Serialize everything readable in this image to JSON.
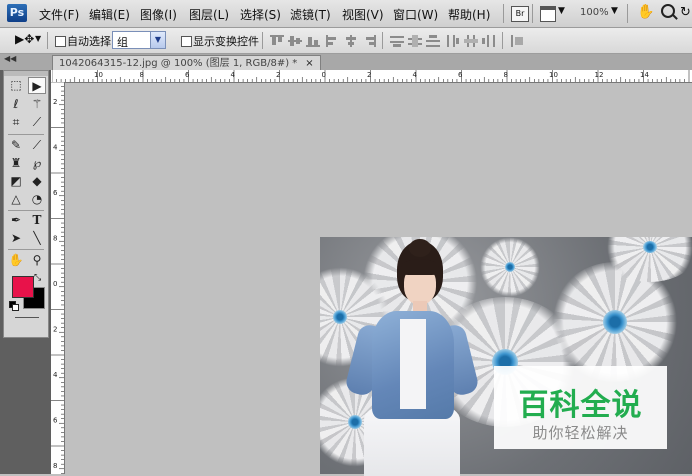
{
  "app": {
    "logo_text": "Ps"
  },
  "menu": [
    {
      "label": "文件(F)"
    },
    {
      "label": "编辑(E)"
    },
    {
      "label": "图像(I)"
    },
    {
      "label": "图层(L)"
    },
    {
      "label": "选择(S)"
    },
    {
      "label": "滤镜(T)"
    },
    {
      "label": "视图(V)"
    },
    {
      "label": "窗口(W)"
    },
    {
      "label": "帮助(H)"
    }
  ],
  "appbar": {
    "view_button_label": "Br",
    "zoom": "100%"
  },
  "options": {
    "auto_select_label": "自动选择:",
    "auto_select_checked": false,
    "layer_mode_value": "组",
    "show_transform_label": "显示变换控件",
    "show_transform_checked": false
  },
  "document": {
    "tab_title": "1042064315-12.jpg @ 100% (图层 1, RGB/8#) *",
    "close_symbol": "×"
  },
  "rulers": {
    "top_labels": [
      "10",
      "8",
      "6",
      "4",
      "2",
      "0",
      "2",
      "4",
      "6",
      "8",
      "10",
      "12",
      "14"
    ],
    "left_labels": [
      "2",
      "4",
      "6",
      "8",
      "0",
      "2",
      "4",
      "6",
      "8"
    ]
  },
  "colors": {
    "foreground": "#e8124a",
    "background": "#000000"
  },
  "watermark": {
    "title": "百科全说",
    "subtitle": "助你轻松解决"
  }
}
